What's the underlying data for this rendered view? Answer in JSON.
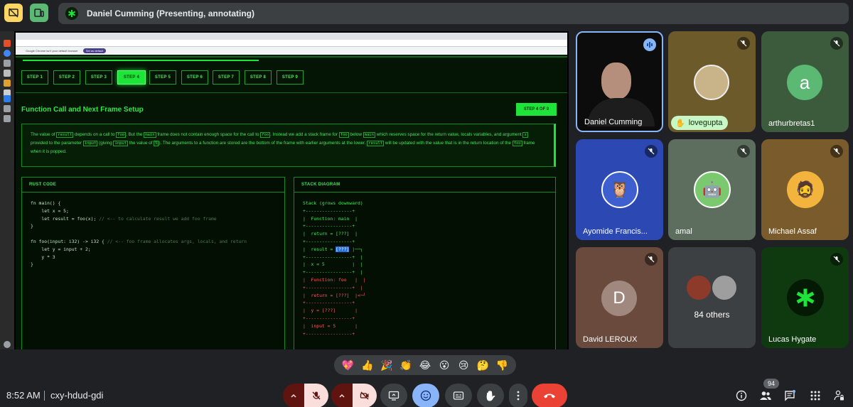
{
  "presenter_banner": {
    "text": "Daniel Cumming (Presenting, annotating)"
  },
  "shared_screen": {
    "browser_info": "Google Chrome isn't your default browser",
    "set_default": "Set as default",
    "steps": [
      "STEP 1",
      "STEP 2",
      "STEP 3",
      "STEP 4",
      "STEP 5",
      "STEP 6",
      "STEP 7",
      "STEP 8",
      "STEP 9"
    ],
    "active_step": "STEP 4",
    "section_title": "Function Call and Next Frame Setup",
    "step_of": "STEP 4 OF 9",
    "description": {
      "p1": "The value of",
      "c1": "result",
      "p2": "depends on a call to",
      "c2": "foo",
      "p3": ". But the",
      "c3": "main",
      "p4": "frame does not contain enough space for the call to",
      "c4": "foo",
      "p5": ". Instead we add a stack frame for",
      "c5": "foo",
      "p6": "below",
      "c6": "main",
      "p7": "which reserves space for the return value, locals variables, and argument",
      "c7": "x",
      "p8": "provided to the parameter",
      "c8": "input",
      "p9": "(giving",
      "c9": "input",
      "p10": "the value of",
      "c10": "5",
      "p11": "). The arguments to a function are stored are the bottom of the frame with earlier arguments at the lower.",
      "c11": "result",
      "p12": "will be updated with the value that is in the return location of the",
      "c12": "foo",
      "p13": "frame when it is popped."
    },
    "rust_panel": {
      "title": "RUST CODE",
      "lines": [
        "fn main() {",
        "    let x = 5;",
        "    let result = foo(x);",
        "}",
        "",
        "fn foo(input: i32) -> i32 {",
        "    let y = input + 2;",
        "    y * 3",
        "}"
      ],
      "comment_result": " // <-- to calculate result we add foo frame",
      "comment_foo": " // <-- foo frame allocates args, locals, and return"
    },
    "stack_panel": {
      "title": "STACK DIAGRAM",
      "lines_a": [
        "Stack (grows downward)",
        "+-----------------+",
        "|  Function: main  |",
        "+-----------------+",
        "|  return = [???]  |",
        "+-----------------+"
      ],
      "result_pre": "|  result = ",
      "result_hl": "[???]",
      "result_post": " |──┐",
      "lines_b": [
        "+-----------------+  |",
        "|  x = 5          |  |",
        "+-----------------+  |"
      ],
      "lines_red": [
        "|  Function: foo   |  |",
        "+-----------------+  |",
        "|  return = [???]  |<─┘",
        "+-----------------+",
        "|  y = [???]       |",
        "+-----------------+",
        "|  input = 5       |",
        "+-----------------+"
      ]
    }
  },
  "participants": [
    {
      "name": "Daniel Cumming",
      "status": "speaking"
    },
    {
      "name": "lovegupta",
      "status": "hand-raised"
    },
    {
      "name": "arthurbretas1",
      "initial": "a",
      "status": "muted"
    },
    {
      "name": "Ayomide Francis...",
      "status": "muted"
    },
    {
      "name": "amal",
      "status": "muted"
    },
    {
      "name": "Michael Assaf",
      "status": "muted"
    },
    {
      "name": "David LEROUX",
      "initial": "D",
      "status": "muted"
    },
    {
      "name": "84 others"
    },
    {
      "name": "Lucas Hygate",
      "status": "muted"
    }
  ],
  "reactions": [
    "💖",
    "👍",
    "🎉",
    "👏",
    "😂",
    "😮",
    "😢",
    "🤔",
    "👎"
  ],
  "bottom": {
    "time": "8:52 AM",
    "meeting_code": "cxy-hdud-gdi",
    "people_count": "94"
  },
  "colors": {
    "accent_green": "#1ee43a",
    "end_call": "#ea4335",
    "muted_bg": "#f9dedc",
    "active_blue": "#8ab4f8"
  },
  "icons": {
    "top": [
      "presentation-off-icon",
      "layout-icon",
      "project-logo-icon"
    ],
    "controls": [
      "chevron-up-icon",
      "mic-off-icon",
      "chevron-up-icon",
      "camera-off-icon",
      "present-screen-icon",
      "emoji-icon",
      "captions-icon",
      "raise-hand-icon",
      "more-options-icon",
      "end-call-icon"
    ],
    "right": [
      "info-icon",
      "people-icon",
      "chat-icon",
      "activities-icon",
      "lock-person-icon"
    ]
  }
}
